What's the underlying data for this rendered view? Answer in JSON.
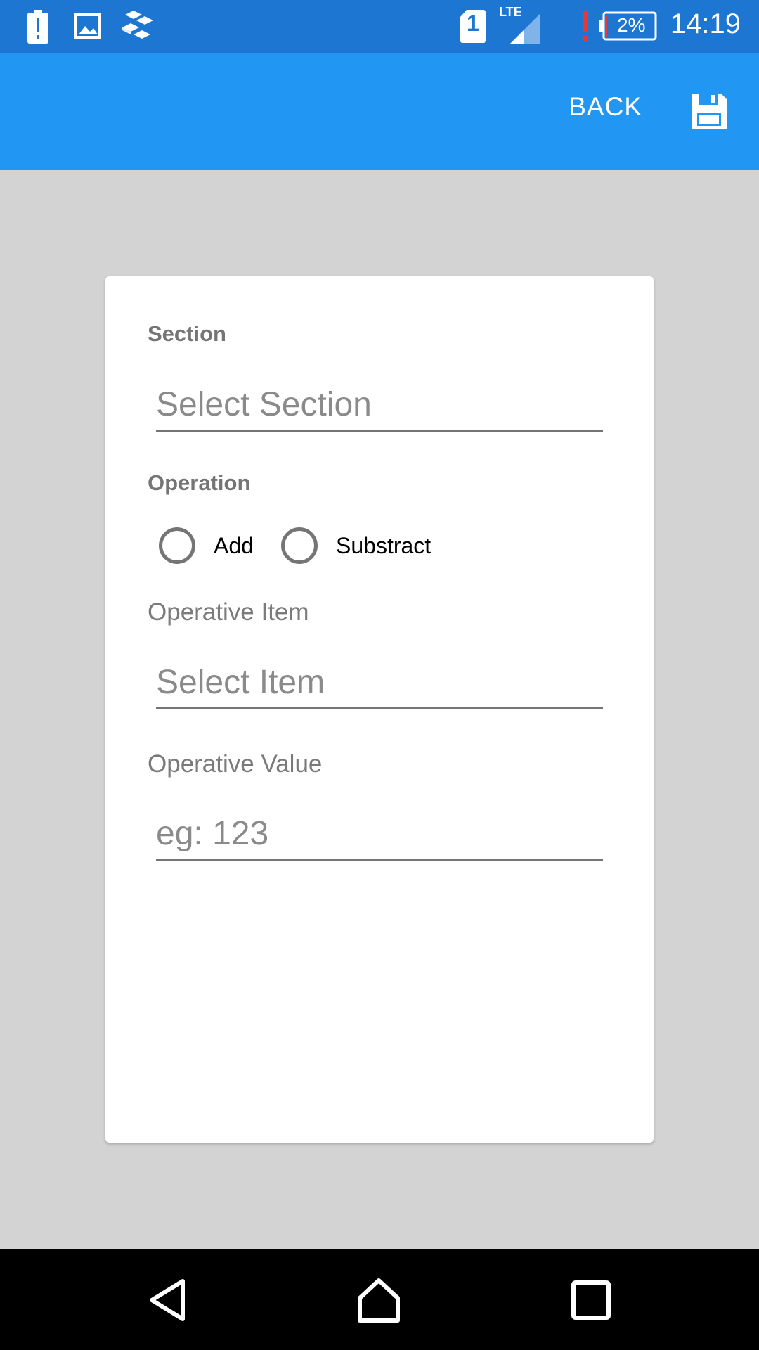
{
  "status_bar": {
    "time": "14:19",
    "battery": "2%",
    "network": "LTE",
    "sim": "1",
    "icons": [
      "battery-alert-icon",
      "image-icon",
      "cubes-icon",
      "sim-icon",
      "signal-icon",
      "alert-icon",
      "battery-icon"
    ]
  },
  "app_bar": {
    "back_label": "BACK",
    "save_icon": "floppy-disk-icon",
    "color": "#2196f3"
  },
  "form": {
    "section_label": "Section",
    "section_placeholder": "Select Section",
    "operation_label": "Operation",
    "operation_options": [
      "Add",
      "Substract"
    ],
    "operative_item_label": "Operative Item",
    "operative_item_placeholder": "Select Item",
    "operative_value_label": "Operative Value",
    "operative_value_placeholder": "eg: 123"
  },
  "nav_bar": {
    "icons": [
      "back-triangle-icon",
      "home-icon",
      "recents-icon"
    ]
  }
}
